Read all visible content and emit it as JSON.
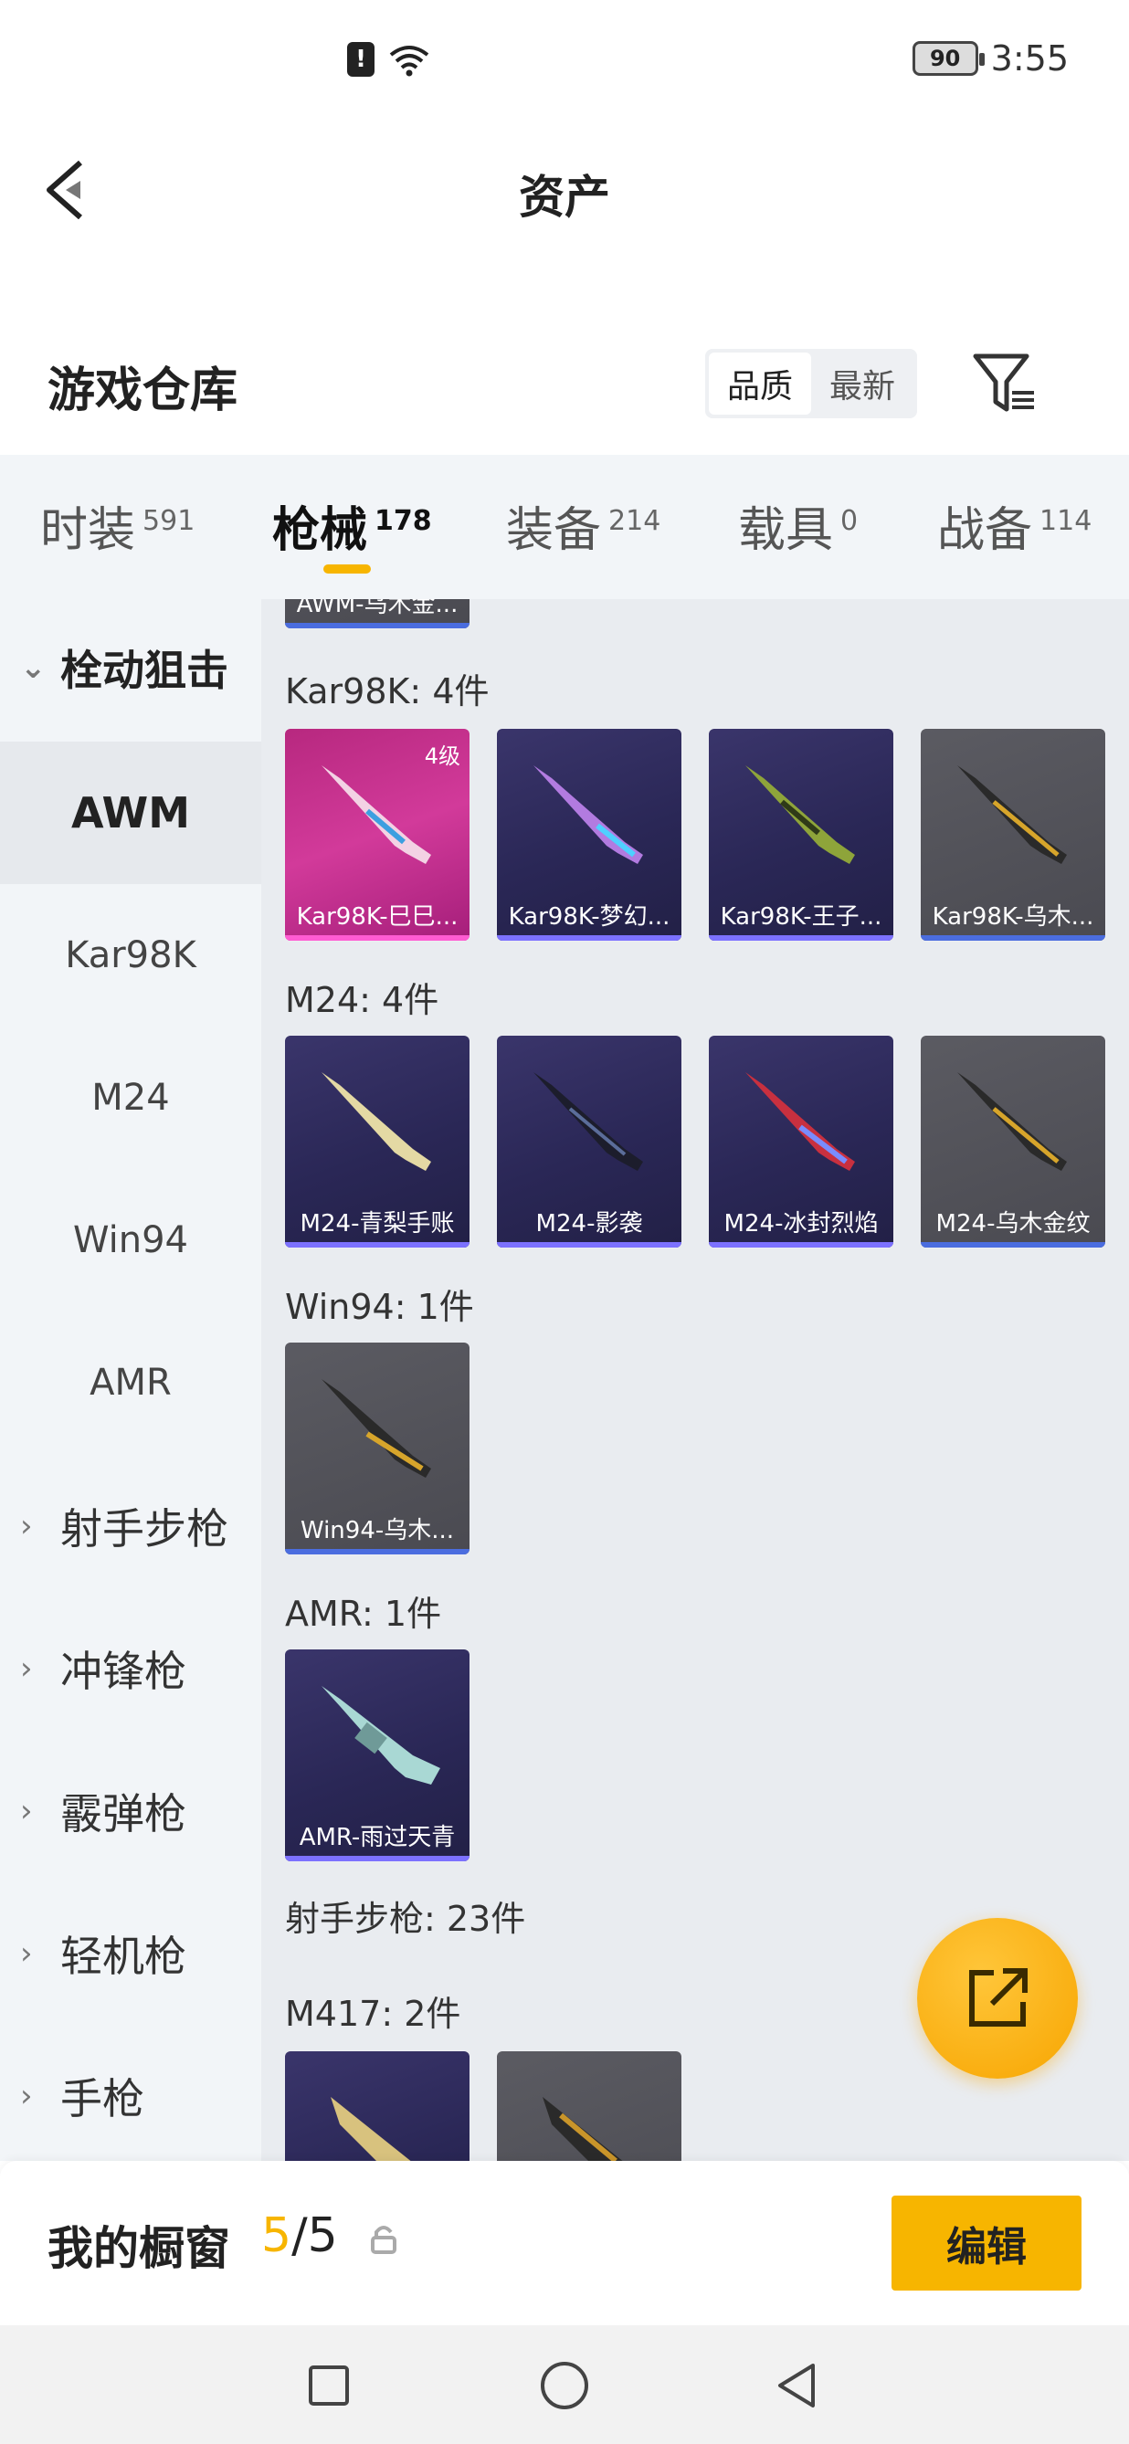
{
  "status_bar": {
    "battery": "90",
    "time": "3:55"
  },
  "header": {
    "title": "资产"
  },
  "warehouse": {
    "title": "游戏仓库",
    "sort_options": [
      "品质",
      "最新"
    ]
  },
  "tabs": [
    {
      "label": "时装",
      "count": "591"
    },
    {
      "label": "枪械",
      "count": "178"
    },
    {
      "label": "装备",
      "count": "214"
    },
    {
      "label": "载具",
      "count": "0"
    },
    {
      "label": "战备",
      "count": "114"
    }
  ],
  "sidebar": {
    "groups": [
      {
        "label": "栓动狙击"
      },
      {
        "label": "射手步枪"
      },
      {
        "label": "冲锋枪"
      },
      {
        "label": "霰弹枪"
      },
      {
        "label": "轻机枪"
      },
      {
        "label": "手枪"
      }
    ],
    "subitems": [
      "AWM",
      "Kar98K",
      "M24",
      "Win94",
      "AMR"
    ]
  },
  "content": {
    "top_partial_card": "AWM-乌木金...",
    "sections": [
      {
        "label": "Kar98K: 4件",
        "items": [
          {
            "name": "Kar98K-巳巳...",
            "level": "4级"
          },
          {
            "name": "Kar98K-梦幻..."
          },
          {
            "name": "Kar98K-王子..."
          },
          {
            "name": "Kar98K-乌木..."
          }
        ]
      },
      {
        "label": "M24: 4件",
        "items": [
          {
            "name": "M24-青梨手账"
          },
          {
            "name": "M24-影袭"
          },
          {
            "name": "M24-冰封烈焰"
          },
          {
            "name": "M24-乌木金纹"
          }
        ]
      },
      {
        "label": "Win94: 1件",
        "items": [
          {
            "name": "Win94-乌木..."
          }
        ]
      },
      {
        "label": "AMR: 1件",
        "items": [
          {
            "name": "AMR-雨过天青"
          }
        ]
      }
    ],
    "category_label": "射手步枪: 23件",
    "m417_label": "M417: 2件"
  },
  "bottom": {
    "title": "我的橱窗",
    "used": "5",
    "sep_total": "/5",
    "edit_label": "编辑"
  },
  "colors": {
    "accent": "#f7b500",
    "purple_card": "#2a2756",
    "pink_card": "#c02c8a",
    "gray_card": "#515158"
  }
}
